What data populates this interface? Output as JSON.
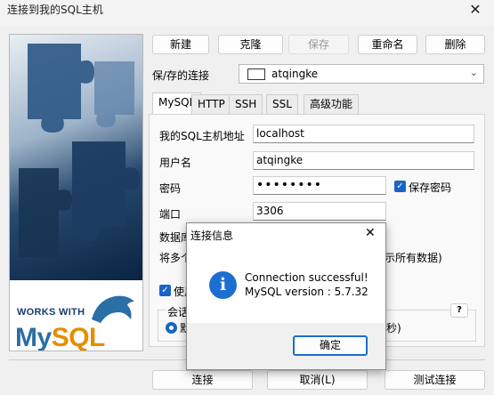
{
  "window": {
    "title": "连接到我的SQL主机",
    "close_glyph": "✕"
  },
  "banner": {
    "works_with": "WORKS WITH",
    "logo_my": "My",
    "logo_sql": "SQL"
  },
  "toolbar": {
    "new": "新建",
    "clone": "克隆",
    "save": "保存",
    "rename": "重命名",
    "delete": "删除"
  },
  "connection": {
    "label": "保/存的连接",
    "selected": "atqingke"
  },
  "tabs": [
    "MySQL",
    "HTTP",
    "SSH",
    "SSL",
    "高级功能"
  ],
  "form": {
    "host_label": "我的SQL主机地址",
    "host_value": "localhost",
    "user_label": "用户名",
    "user_value": "atqingke",
    "password_label": "密码",
    "password_value": "••••••••",
    "save_password_label": "保存密码",
    "port_label": "端口",
    "port_value": "3306",
    "database_label": "数据库/",
    "multi_label": "将多个",
    "show_all_fragment": "示所有数据)",
    "use_label": "使用",
    "session_label": "会话",
    "default_label": "默",
    "seconds_fragment": "秒)",
    "help_glyph": "?"
  },
  "bottom": {
    "connect": "连接",
    "cancel": "取消(L)",
    "test": "测试连接"
  },
  "dialog": {
    "title": "连接信息",
    "close_glyph": "✕",
    "icon_glyph": "i",
    "message_line1": "Connection successful!",
    "message_line2": "MySQL version : 5.7.32",
    "ok": "确定"
  }
}
